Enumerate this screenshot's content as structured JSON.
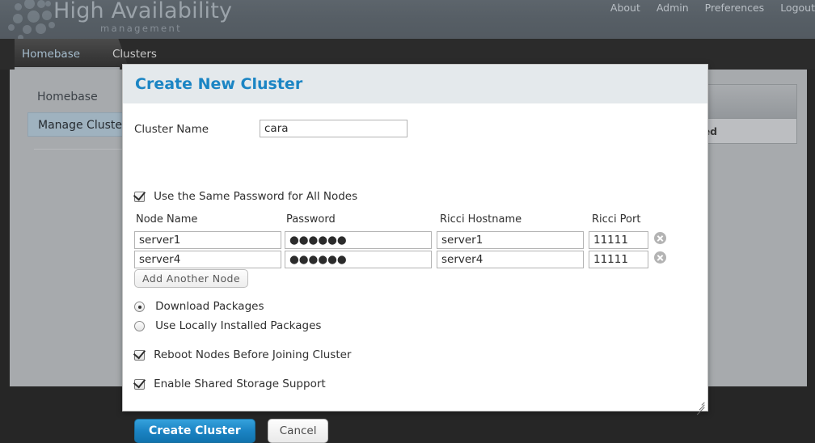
{
  "banner": {
    "title": "High Availability",
    "subtitle": "management",
    "logo_icon": "dots-hexagon-logo-icon",
    "topnav": [
      {
        "label": "About"
      },
      {
        "label": "Admin"
      },
      {
        "label": "Preferences"
      },
      {
        "label": "Logout"
      }
    ]
  },
  "breadcrumb": {
    "items": [
      {
        "label": "Homebase"
      },
      {
        "label": "Clusters"
      }
    ],
    "separator_icon": "chevron-right-icon"
  },
  "sidebar": {
    "heading": "Homebase",
    "items": [
      {
        "label": "Manage Clusters",
        "selected": true
      }
    ]
  },
  "background_table": {
    "columns": [
      {
        "label": "Nodes Joined"
      }
    ]
  },
  "modal": {
    "title": "Create New Cluster",
    "cluster_name": {
      "label": "Cluster Name",
      "value": "cara",
      "placeholder": ""
    },
    "same_password": {
      "label": "Use the Same Password for All Nodes",
      "checked": true
    },
    "node_table": {
      "columns": [
        {
          "label": "Node Name"
        },
        {
          "label": "Password"
        },
        {
          "label": "Ricci Hostname"
        },
        {
          "label": "Ricci Port"
        }
      ],
      "rows": [
        {
          "node_name": "server1",
          "password": "●●●●●●",
          "ricci_hostname": "server1",
          "ricci_port": "11111",
          "delete_icon": "remove-circle-icon"
        },
        {
          "node_name": "server4",
          "password": "●●●●●●",
          "ricci_hostname": "server4",
          "ricci_port": "11111",
          "delete_icon": "remove-circle-icon"
        }
      ]
    },
    "add_node_button": "Add Another Node",
    "package_options": [
      {
        "label": "Download Packages",
        "selected": true
      },
      {
        "label": "Use Locally Installed Packages",
        "selected": false
      }
    ],
    "reboot_nodes": {
      "label": "Reboot Nodes Before Joining Cluster",
      "checked": true
    },
    "shared_storage": {
      "label": "Enable Shared Storage Support",
      "checked": true
    },
    "create_button": "Create Cluster",
    "cancel_button": "Cancel",
    "resize_icon": "resize-grip-icon"
  },
  "colors": {
    "accent_blue": "#1b85c4",
    "banner_bg": "#565e65",
    "modal_header_bg": "#e4e9ec",
    "page_bg": "#262626",
    "panel_bg": "#a7aaad"
  }
}
